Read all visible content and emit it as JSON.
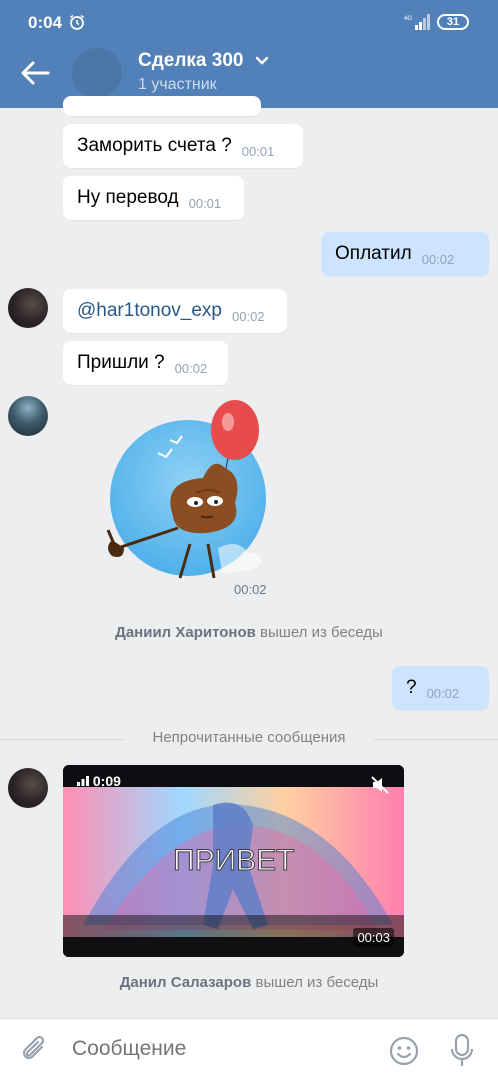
{
  "status": {
    "time": "0:04",
    "network": "4G",
    "battery": "31"
  },
  "header": {
    "title": "Сделка 300",
    "subtitle": "1 участник"
  },
  "messages": [
    {
      "text": "Заморить счета ?",
      "time": "00:01"
    },
    {
      "text": "Ну перевод",
      "time": "00:01"
    },
    {
      "text": "Оплатил",
      "time": "00:02"
    },
    {
      "text": "@har1tonov_exp",
      "time": "00:02"
    },
    {
      "text": "Пришли ?",
      "time": "00:02"
    },
    {
      "text": "?",
      "time": "00:02"
    }
  ],
  "sticker": {
    "time": "00:02"
  },
  "service": [
    {
      "name": "Даниил Харитонов",
      "action": "вышел из беседы"
    },
    {
      "name": "Данил Салазаров",
      "action": "вышел из беседы"
    }
  ],
  "unread_label": "Непрочитанные сообщения",
  "video": {
    "duration": "0:09",
    "time": "00:03",
    "caption": "ПРИВЕТ"
  },
  "composer": {
    "placeholder": "Сообщение"
  }
}
